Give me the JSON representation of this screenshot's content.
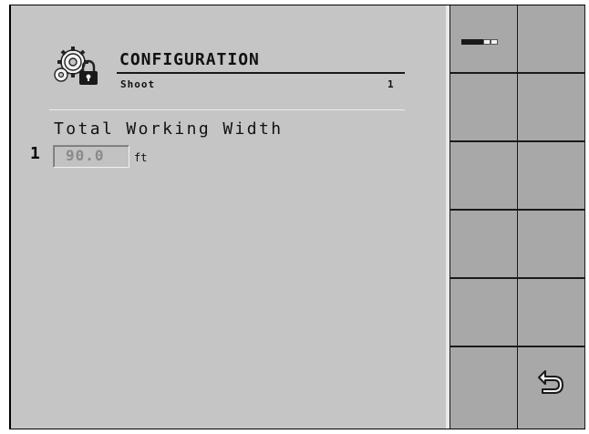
{
  "header": {
    "title": "CONFIGURATION",
    "subtitle": "Shoot",
    "subtitle_number": "1",
    "icon": "gears-lock-icon"
  },
  "field": {
    "index": "1",
    "label": "Total Working Width",
    "value": "90.0",
    "unit": "ft"
  },
  "softkeys": {
    "page_indicator": {
      "icon": "page-indicator-icon",
      "total_pages": 5,
      "current_pages_filled": 3
    },
    "back_button": {
      "icon": "return-arrow-icon"
    }
  },
  "colors": {
    "background": "#c5c5c5",
    "softkey": "#a8a8a8",
    "softkey_border": "#1a1a1a",
    "text": "#111111",
    "field_text": "#8a8a8a"
  }
}
